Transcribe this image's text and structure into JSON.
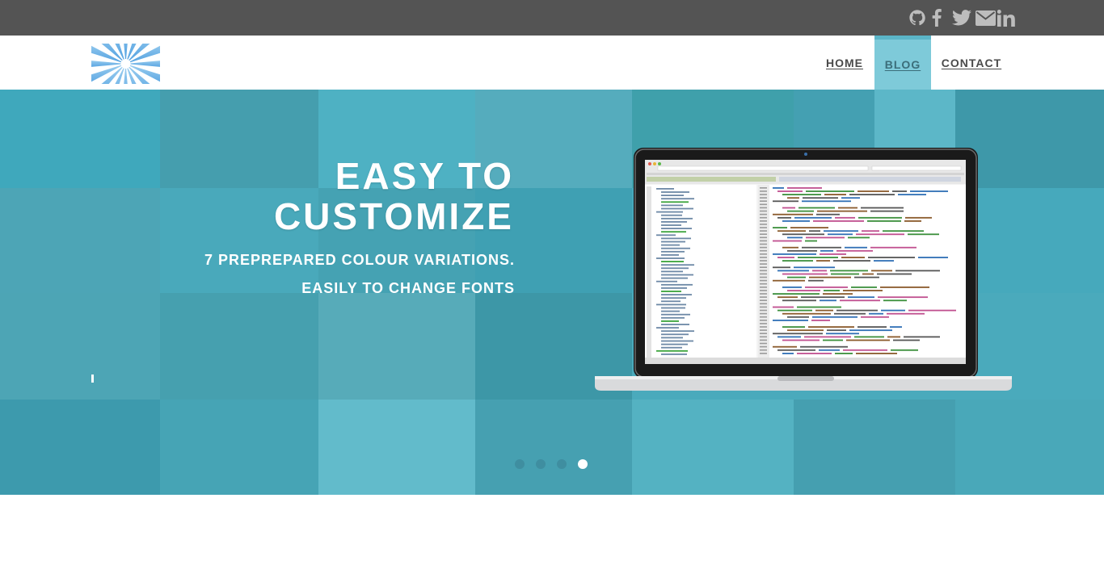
{
  "topbar": {
    "social": [
      {
        "icon": "github-icon"
      },
      {
        "icon": "facebook-icon"
      },
      {
        "icon": "twitter-icon"
      },
      {
        "icon": "mail-icon"
      },
      {
        "icon": "linkedin-icon"
      }
    ],
    "icon_color": "#bdbdbd",
    "background": "#545454"
  },
  "header": {
    "logo_icon": "starburst-logo",
    "nav": [
      {
        "label": "HOME"
      },
      {
        "label": "BLOG"
      },
      {
        "label": "CONTACT"
      }
    ],
    "active_item": "BLOG",
    "accent": "#7ecad9"
  },
  "hero": {
    "title_line1": "EASY TO",
    "title_line2": "CUSTOMIZE",
    "subtitle1": "7 PREPREPARED COLOUR VARIATIONS.",
    "subtitle2": "EASILY TO CHANGE FONTS",
    "image": "laptop-with-code-editor",
    "tint_color": "#45aec2",
    "slides_count": 4,
    "active_slide": 4
  }
}
